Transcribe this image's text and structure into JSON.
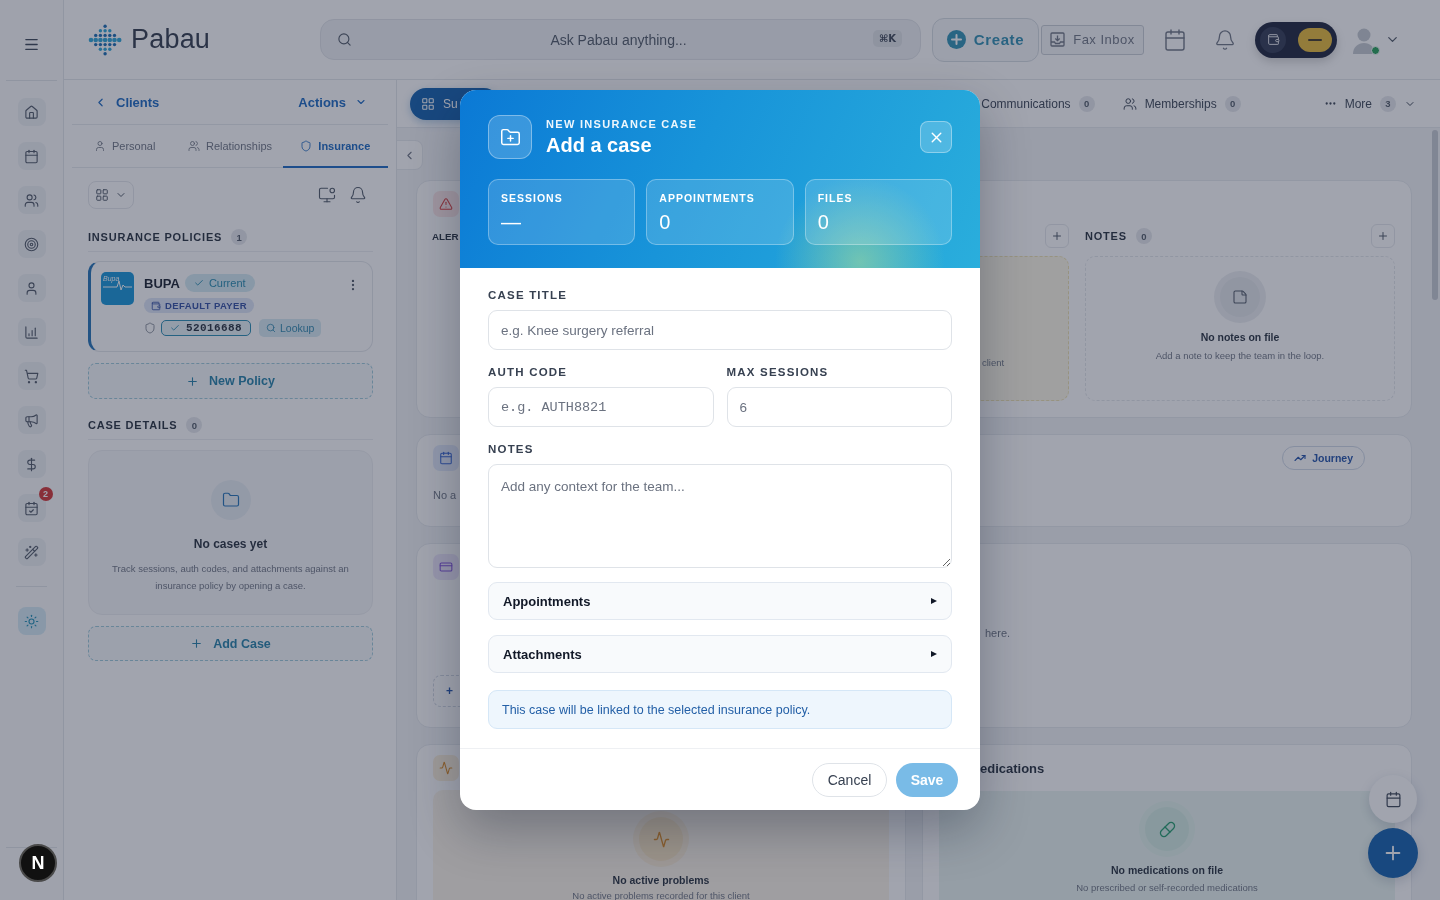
{
  "rail": {
    "items": [
      {
        "selected": false
      },
      {
        "selected": false
      },
      {
        "selected": false
      },
      {
        "selected": false
      },
      {
        "selected": false
      },
      {
        "selected": false
      },
      {
        "selected": false
      },
      {
        "selected": false
      },
      {
        "selected": false
      },
      {
        "selected": false,
        "badge": "2"
      },
      {
        "selected": false
      }
    ],
    "tools": [
      {
        "selected": true
      }
    ],
    "dev_badge": "N"
  },
  "header": {
    "logo": "Pabau",
    "search": {
      "placeholder": "Ask Pabau anything...",
      "shortcut": "⌘K"
    },
    "create": "Create",
    "fax_inbox": "Fax Inbox",
    "mode_toggle": {
      "on": true
    }
  },
  "client_panel": {
    "back": "Clients",
    "actions": "Actions",
    "tabs": [
      {
        "label": "Personal",
        "selected": false
      },
      {
        "label": "Relationships",
        "selected": false
      },
      {
        "label": "Insurance",
        "selected": true
      }
    ],
    "insurance_policies": {
      "title": "INSURANCE POLICIES",
      "count": "1",
      "policies": [
        {
          "logo": "Bupa",
          "name": "BUPA",
          "status": "Current",
          "default_payer": "DEFAULT PAYER",
          "member_number": "52016688",
          "lookup": "Lookup"
        }
      ],
      "new_policy": "New Policy"
    },
    "case_details": {
      "title": "CASE DETAILS",
      "count": "0",
      "empty_title": "No cases yet",
      "empty_text": "Track sessions, auth codes, and attachments against an insurance policy by opening a case.",
      "add_case": "Add Case"
    }
  },
  "main": {
    "tabs": [
      {
        "label": "Su",
        "kind": "pill",
        "selected": true
      },
      {
        "label": "Communications",
        "count": "0",
        "kind": "tab",
        "selected": false
      },
      {
        "label": "Memberships",
        "count": "0",
        "kind": "tab",
        "selected": false
      },
      {
        "label": "More",
        "count": "3",
        "kind": "menu",
        "selected": false
      }
    ],
    "alerts_card": {
      "column_1": {
        "title": "ALER"
      },
      "column_2": {
        "text": "client"
      },
      "notes": {
        "title": "NOTES",
        "count": "0",
        "empty_title": "No notes on file",
        "empty_text": "Add a note to keep the team in the loop."
      }
    },
    "appointments_card": {
      "text": "No a",
      "journey": "Journey"
    },
    "card_3": {
      "text": "here.",
      "add_button": "+"
    },
    "problems_card": {
      "empty_title": "No active problems",
      "empty_text": "No active problems recorded for this client"
    },
    "medications_card": {
      "title": "edications",
      "empty_title": "No medications on file",
      "empty_text": "No prescribed or self-recorded medications"
    }
  },
  "modal": {
    "eyebrow": "NEW INSURANCE CASE",
    "title": "Add a case",
    "stats": [
      {
        "label": "SESSIONS",
        "value": "—"
      },
      {
        "label": "APPOINTMENTS",
        "value": "0"
      },
      {
        "label": "FILES",
        "value": "0"
      }
    ],
    "case_title": {
      "label": "CASE TITLE",
      "placeholder": "e.g. Knee surgery referral"
    },
    "auth_code": {
      "label": "AUTH CODE",
      "placeholder": "e.g. AUTH8821"
    },
    "max_sessions": {
      "label": "MAX SESSIONS",
      "placeholder": "6"
    },
    "notes": {
      "label": "NOTES",
      "placeholder": "Add any context for the team..."
    },
    "sections": [
      {
        "label": "Appointments",
        "expanded": false
      },
      {
        "label": "Attachments",
        "expanded": false
      }
    ],
    "info": "This case will be linked to the selected insurance policy.",
    "cancel": "Cancel",
    "save": {
      "label": "Save",
      "disabled": true
    }
  }
}
